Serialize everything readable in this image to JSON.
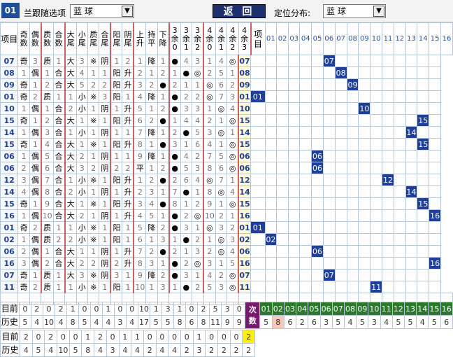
{
  "toolbar": {
    "index": "01",
    "choose_label": "兰跟随选项",
    "choose_value": "蓝      球",
    "return_label": "返 回",
    "pos_label": "定位分布:",
    "pos_value": "蓝      球"
  },
  "header": {
    "left": "项目",
    "cols": [
      "奇数",
      "偶数",
      "质数",
      "合数",
      "大尾",
      "小尾",
      "质尾",
      "合尾",
      "阳尾",
      "阴尾",
      "上升",
      "持平",
      "下降"
    ],
    "mods": [
      "3余0",
      "3余1",
      "3余2",
      "4余0",
      "4余1",
      "4余2",
      "4余3"
    ],
    "right": "项目",
    "digits": [
      "01",
      "02",
      "03",
      "04",
      "05",
      "06",
      "07",
      "08",
      "09",
      "10",
      "11",
      "12",
      "13",
      "14",
      "15",
      "16"
    ]
  },
  "rows": [
    {
      "issue": "07",
      "cells": [
        "奇",
        "3",
        "质",
        "1",
        "大",
        "3",
        "※",
        "阴",
        "1",
        "2",
        "1",
        "降",
        "1",
        "●",
        "4",
        "3",
        "1",
        "4",
        "◎"
      ],
      "hit": 7
    },
    {
      "issue": "08",
      "cells": [
        "1",
        "偶",
        "1",
        "合",
        "大",
        "4",
        "1",
        "1",
        "阳",
        "升",
        "2",
        "1",
        "2",
        "1",
        "●",
        "◎",
        "2",
        "5",
        "1"
      ],
      "hit": 8
    },
    {
      "issue": "09",
      "cells": [
        "奇",
        "1",
        "2",
        "合",
        "大",
        "5",
        "2",
        "2",
        "阳",
        "升",
        "3",
        "2",
        "●",
        "2",
        "1",
        "1",
        "◎",
        "6",
        "2"
      ],
      "hit": 9
    },
    {
      "issue": "01",
      "cells": [
        "奇",
        "2",
        "质",
        "1",
        "1",
        "小",
        "※",
        "3",
        "阳",
        "1",
        "4",
        "降",
        "1",
        "●",
        "2",
        "2",
        "◎",
        "7",
        "3"
      ],
      "hit": 1
    },
    {
      "issue": "10",
      "cells": [
        "1",
        "偶",
        "1",
        "合",
        "2",
        "小",
        "1",
        "阴",
        "1",
        "升",
        "5",
        "1",
        "2",
        "●",
        "3",
        "3",
        "1",
        "◎",
        "4"
      ],
      "hit": 10
    },
    {
      "issue": "15",
      "cells": [
        "奇",
        "1",
        "2",
        "合",
        "大",
        "1",
        "※",
        "1",
        "阳",
        "升",
        "6",
        "2",
        "●",
        "1",
        "4",
        "4",
        "2",
        "1",
        "◎"
      ],
      "hit": 15
    },
    {
      "issue": "14",
      "cells": [
        "1",
        "偶",
        "3",
        "合",
        "1",
        "小",
        "1",
        "阴",
        "1",
        "1",
        "7",
        "降",
        "1",
        "2",
        "●",
        "5",
        "3",
        "◎",
        "1"
      ],
      "hit": 14
    },
    {
      "issue": "15",
      "cells": [
        "奇",
        "1",
        "4",
        "合",
        "大",
        "1",
        "※",
        "1",
        "阳",
        "升",
        "8",
        "1",
        "●",
        "3",
        "1",
        "6",
        "4",
        "1",
        "◎"
      ],
      "hit": 15
    },
    {
      "issue": "06",
      "cells": [
        "1",
        "偶",
        "5",
        "合",
        "大",
        "2",
        "1",
        "阴",
        "1",
        "1",
        "9",
        "降",
        "1",
        "●",
        "4",
        "2",
        "7",
        "5",
        "◎"
      ],
      "hit": 6
    },
    {
      "issue": "06",
      "cells": [
        "2",
        "偶",
        "6",
        "合",
        "大",
        "3",
        "2",
        "阴",
        "2",
        "2",
        "平",
        "1",
        "2",
        "●",
        "5",
        "3",
        "8",
        "6",
        "◎"
      ],
      "hit": 6
    },
    {
      "issue": "12",
      "cells": [
        "3",
        "偶",
        "7",
        "合",
        "1",
        "小",
        "※",
        "1",
        "阳",
        "升",
        "1",
        "2",
        "●",
        "2",
        "6",
        "4",
        "◎",
        "7",
        "1"
      ],
      "hit": 12
    },
    {
      "issue": "14",
      "cells": [
        "4",
        "偶",
        "8",
        "合",
        "2",
        "小",
        "1",
        "阴",
        "1",
        "升",
        "2",
        "3",
        "1",
        "7",
        "●",
        "1",
        "8",
        "◎",
        "4"
      ],
      "hit": 14
    },
    {
      "issue": "15",
      "cells": [
        "奇",
        "1",
        "9",
        "合",
        "大",
        "1",
        "※",
        "1",
        "阳",
        "升",
        "3",
        "4",
        "●",
        "8",
        "1",
        "2",
        "9",
        "1",
        "◎"
      ],
      "hit": 15
    },
    {
      "issue": "16",
      "cells": [
        "1",
        "偶",
        "10",
        "合",
        "大",
        "2",
        "1",
        "阴",
        "1",
        "升",
        "4",
        "5",
        "1",
        "●",
        "2",
        "◎",
        "10",
        "2",
        "1"
      ],
      "hit": 16
    },
    {
      "issue": "01",
      "cells": [
        "奇",
        "2",
        "质",
        "1",
        "1",
        "小",
        "※",
        "1",
        "阳",
        "1",
        "5",
        "降",
        "2",
        "●",
        "3",
        "1",
        "◎",
        "3",
        "2"
      ],
      "hit": 1
    },
    {
      "issue": "02",
      "cells": [
        "1",
        "偶",
        "质",
        "2",
        "2",
        "小",
        "※",
        "1",
        "阳",
        "1",
        "6",
        "1",
        "3",
        "1",
        "●",
        "2",
        "1",
        "◎",
        "3"
      ],
      "hit": 2
    },
    {
      "issue": "06",
      "cells": [
        "2",
        "偶",
        "1",
        "合",
        "大",
        "1",
        "1",
        "阴",
        "1",
        "升",
        "7",
        "2",
        "●",
        "2",
        "1",
        "3",
        "2",
        "◎",
        "4"
      ],
      "hit": 6
    },
    {
      "issue": "16",
      "cells": [
        "3",
        "偶",
        "2",
        "合",
        "大",
        "2",
        "2",
        "阴",
        "2",
        "升",
        "8",
        "3",
        "1",
        "●",
        "2",
        "◎",
        "3",
        "1",
        "5"
      ],
      "hit": 16
    },
    {
      "issue": "07",
      "cells": [
        "奇",
        "1",
        "质",
        "1",
        "大",
        "3",
        "※",
        "阴",
        "3",
        "1",
        "9",
        "降",
        "2",
        "●",
        "3",
        "1",
        "4",
        "2",
        "◎"
      ],
      "hit": 7
    },
    {
      "issue": "11",
      "cells": [
        "奇",
        "2",
        "质",
        "1",
        "1",
        "小",
        "※",
        "1",
        "阳",
        "1",
        "10",
        "1",
        "3",
        "1",
        "●",
        "2",
        "5",
        "3",
        "◎"
      ],
      "hit": 11
    }
  ],
  "footer1": {
    "label_now": "目前",
    "label_hist": "历史",
    "now": [
      "0",
      "2",
      "0",
      "2",
      "1",
      "0",
      "0",
      "1",
      "0",
      "0",
      "10",
      "1",
      "3",
      "1",
      "0",
      "2",
      "5",
      "3",
      "0"
    ],
    "hist": [
      "5",
      "4",
      "10",
      "4",
      "8",
      "5",
      "4",
      "4",
      "3",
      "4",
      "17",
      "5",
      "5",
      "8",
      "6",
      "8",
      "11",
      "9",
      "9"
    ],
    "cishu": "次数",
    "digits": [
      "01",
      "02",
      "03",
      "04",
      "05",
      "06",
      "07",
      "08",
      "09",
      "10",
      "11",
      "12",
      "13",
      "14",
      "15",
      "16"
    ],
    "counts": [
      "5",
      "8",
      "6",
      "2",
      "6",
      "3",
      "5",
      "4",
      "5",
      "3",
      "4",
      "5",
      "5",
      "4",
      "5",
      "6"
    ]
  },
  "footer2": {
    "label_now": "目前",
    "label_hist": "历史",
    "now": [
      "2",
      "0",
      "2",
      "0",
      "0",
      "1",
      "2",
      "0",
      "1",
      "1",
      "0",
      "0",
      "0",
      "0",
      "1",
      "0",
      "0",
      "0",
      "2"
    ],
    "hist": [
      "4",
      "5",
      "4",
      "10",
      "5",
      "8",
      "4",
      "3",
      "4",
      "4",
      "2",
      "4",
      "4",
      "2",
      "3",
      "2",
      "2",
      "2",
      "2"
    ]
  }
}
